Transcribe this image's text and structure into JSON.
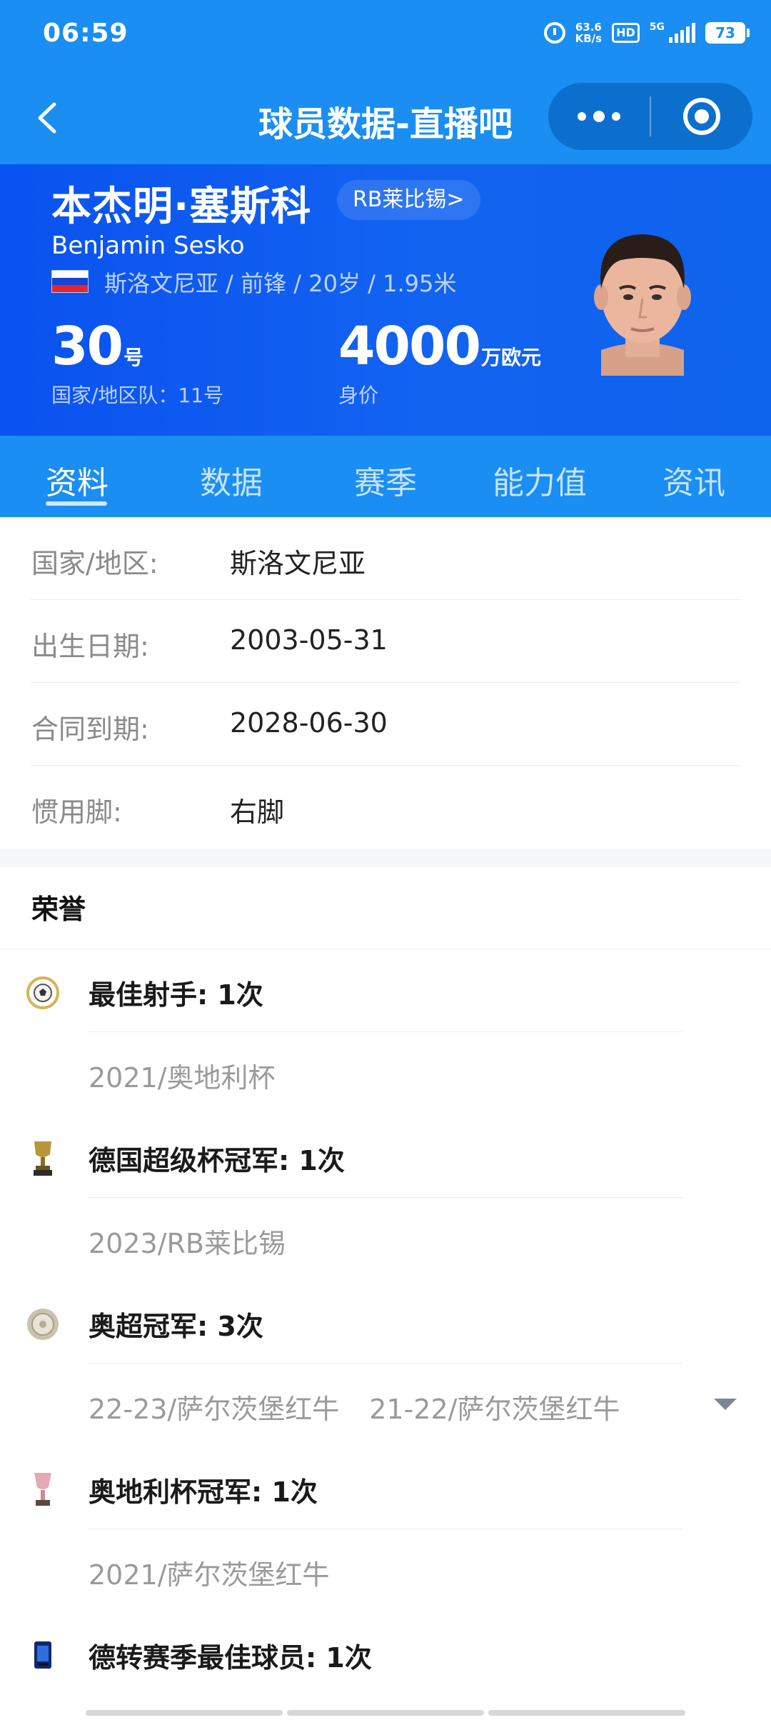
{
  "status_bar": {
    "time": "06:59",
    "net_speed_value": "63.6",
    "net_speed_unit": "KB/s",
    "hd": "HD",
    "network": "5G",
    "battery": "73"
  },
  "nav": {
    "title": "球员数据-直播吧"
  },
  "player": {
    "name_cn": "本杰明·塞斯科",
    "club_link": "RB莱比锡>",
    "name_en": "Benjamin Sesko",
    "meta": "斯洛文尼亚 / 前锋 / 20岁 / 1.95米",
    "number": "30",
    "number_unit": "号",
    "national_team_number": "国家/地区队：11号",
    "value": "4000",
    "value_unit": "万欧元",
    "value_caption": "身价"
  },
  "tabs": [
    {
      "label": "资料",
      "active": true
    },
    {
      "label": "数据",
      "active": false
    },
    {
      "label": "赛季",
      "active": false
    },
    {
      "label": "能力值",
      "active": false
    },
    {
      "label": "资讯",
      "active": false
    }
  ],
  "info": [
    {
      "label": "国家/地区:",
      "value": "斯洛文尼亚"
    },
    {
      "label": "出生日期:",
      "value": "2003-05-31"
    },
    {
      "label": "合同到期:",
      "value": "2028-06-30"
    },
    {
      "label": "惯用脚:",
      "value": "右脚"
    }
  ],
  "honors": {
    "title": "荣誉",
    "items": [
      {
        "icon": "golden-boot-ball-icon",
        "title": "最佳射手: 1次",
        "details": [
          "2021/奥地利杯"
        ]
      },
      {
        "icon": "trophy-icon",
        "title": "德国超级杯冠军: 1次",
        "details": [
          "2023/RB莱比锡"
        ]
      },
      {
        "icon": "plate-trophy-icon",
        "title": "奥超冠军: 3次",
        "details": [
          "22-23/萨尔茨堡红牛",
          "21-22/萨尔茨堡红牛"
        ],
        "expandable": true
      },
      {
        "icon": "cup-trophy-icon",
        "title": "奥地利杯冠军: 1次",
        "details": [
          "2021/萨尔茨堡红牛"
        ]
      },
      {
        "icon": "award-card-icon",
        "title": "德转赛季最佳球员: 1次",
        "details": []
      }
    ]
  },
  "colors": {
    "primary": "#1a8ef2",
    "header_gradient": "#0a52f0",
    "capsule": "#0c6fce"
  }
}
